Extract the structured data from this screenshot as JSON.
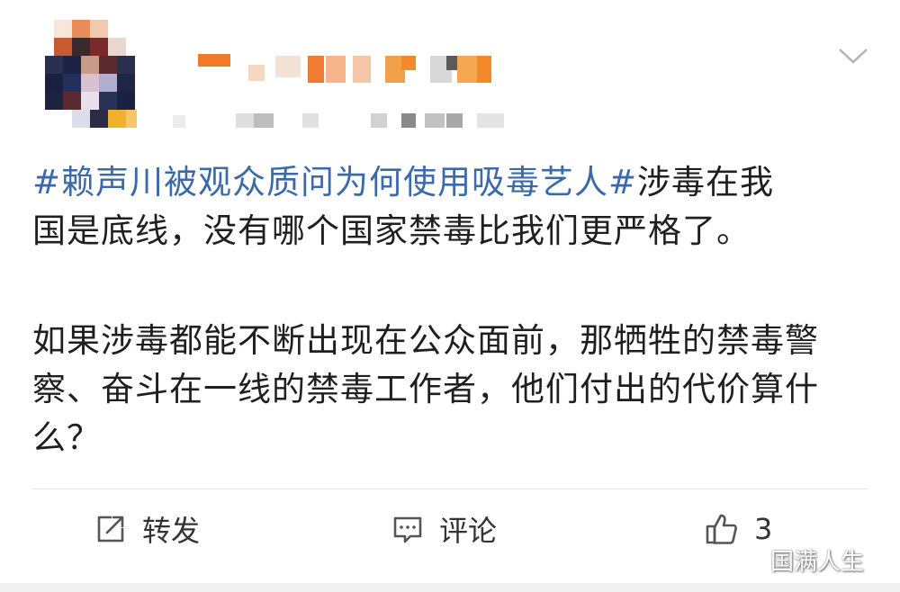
{
  "post": {
    "hashtag": "#赖声川被观众质问为何使用吸毒艺人#",
    "line1_rest": "涉毒在我",
    "line2": "国是底线，没有哪个国家禁毒比我们更严格了。",
    "para2": "如果涉毒都能不断出现在公众面前，那牺牲的禁毒警察、奋斗在一线的禁毒工作者，他们付出的代价算什么？"
  },
  "actions": {
    "forward_label": "转发",
    "comment_label": "评论",
    "like_count": "3"
  },
  "icons": {
    "more": "chevron-down-icon",
    "forward": "share-icon",
    "comment": "comment-icon",
    "like": "thumbs-up-icon"
  },
  "watermark": "国满人生",
  "colors": {
    "hashtag": "#3b6aa8",
    "text": "#1f1f1f",
    "action": "#333333"
  }
}
